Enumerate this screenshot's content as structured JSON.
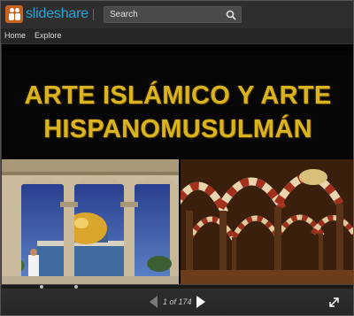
{
  "header": {
    "logo_text": "slideshare",
    "search_placeholder": "Search"
  },
  "nav": {
    "home": "Home",
    "explore": "Explore"
  },
  "slide": {
    "title_line1": "ARTE ISLÁMICO Y ARTE",
    "title_line2": "HISPANOMUSULMÁN"
  },
  "controls": {
    "page_indicator": "1 of 174"
  },
  "colors": {
    "brand": "#27a5d6",
    "logo_orange": "#c8621f",
    "title_gold": "#d9b41f"
  }
}
